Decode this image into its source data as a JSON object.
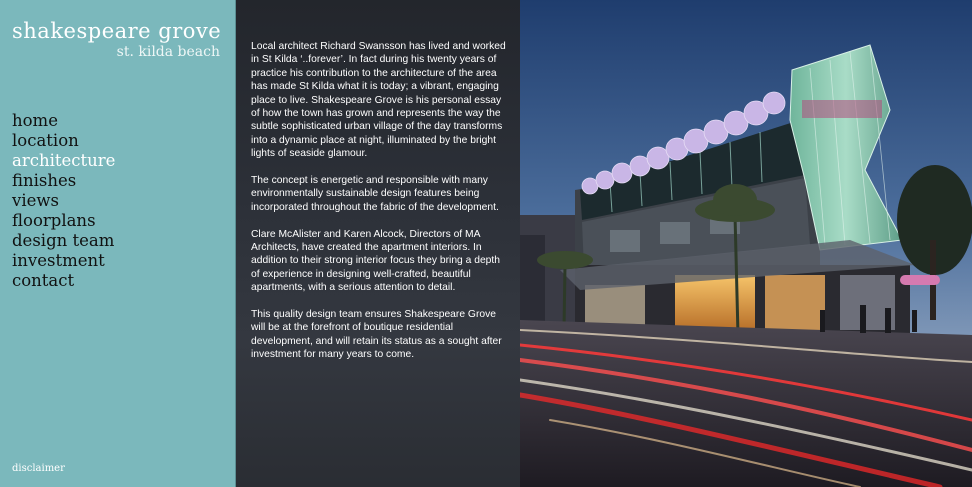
{
  "brand": {
    "title": "shakespeare grove",
    "subtitle": "st. kilda beach"
  },
  "nav": {
    "items": [
      {
        "label": "home",
        "active": false
      },
      {
        "label": "location",
        "active": false
      },
      {
        "label": "architecture",
        "active": true
      },
      {
        "label": "finishes",
        "active": false
      },
      {
        "label": "views",
        "active": false
      },
      {
        "label": "floorplans",
        "active": false
      },
      {
        "label": "design team",
        "active": false
      },
      {
        "label": "investment",
        "active": false
      },
      {
        "label": "contact",
        "active": false
      }
    ]
  },
  "footer": {
    "disclaimer": "disclaimer"
  },
  "content": {
    "paragraphs": [
      "Local architect Richard Swansson has lived and worked in St Kilda ‘..forever’. In fact during his twenty years of practice his contribution to the architecture of the area has made St Kilda what it is today; a vibrant, engaging place to live. Shakespeare Grove is his personal essay of how the town has grown and represents the way the subtle sophisticated urban village of the day transforms into a dynamic place at night, illuminated by the bright lights of seaside glamour.",
      "The concept is energetic and responsible with many environmentally sustainable design features being incorporated throughout the fabric of the development.",
      "Clare McAlister and Karen Alcock, Directors of MA Architects, have created the apartment interiors. In addition to their strong interior focus they bring a depth of experience in designing well-crafted, beautiful apartments, with a serious attention to detail.",
      "This quality design team ensures Shakespeare Grove will be at the forefront of boutique residential development, and will retain its status as a sought after investment for many years to come."
    ]
  },
  "photo": {
    "subject": "architectural-rendering-dusk-street"
  },
  "colors": {
    "sidebar_bg": "#7bb8bc",
    "active_nav": "#ffffff",
    "text_panel_bg": "#2c3038"
  }
}
